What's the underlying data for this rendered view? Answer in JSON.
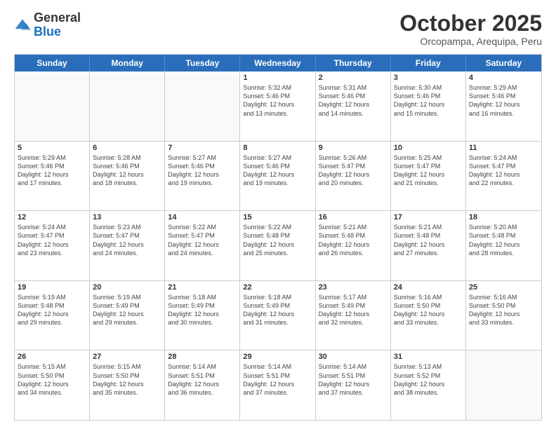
{
  "header": {
    "logo": {
      "line1": "General",
      "line2": "Blue"
    },
    "title": "October 2025",
    "subtitle": "Orcopampa, Arequipa, Peru"
  },
  "calendar": {
    "days_of_week": [
      "Sunday",
      "Monday",
      "Tuesday",
      "Wednesday",
      "Thursday",
      "Friday",
      "Saturday"
    ],
    "rows": [
      [
        {
          "day": "",
          "lines": [],
          "empty": true
        },
        {
          "day": "",
          "lines": [],
          "empty": true
        },
        {
          "day": "",
          "lines": [],
          "empty": true
        },
        {
          "day": "1",
          "lines": [
            "Sunrise: 5:32 AM",
            "Sunset: 5:46 PM",
            "Daylight: 12 hours",
            "and 13 minutes."
          ]
        },
        {
          "day": "2",
          "lines": [
            "Sunrise: 5:31 AM",
            "Sunset: 5:46 PM",
            "Daylight: 12 hours",
            "and 14 minutes."
          ]
        },
        {
          "day": "3",
          "lines": [
            "Sunrise: 5:30 AM",
            "Sunset: 5:46 PM",
            "Daylight: 12 hours",
            "and 15 minutes."
          ]
        },
        {
          "day": "4",
          "lines": [
            "Sunrise: 5:29 AM",
            "Sunset: 5:46 PM",
            "Daylight: 12 hours",
            "and 16 minutes."
          ]
        }
      ],
      [
        {
          "day": "5",
          "lines": [
            "Sunrise: 5:29 AM",
            "Sunset: 5:46 PM",
            "Daylight: 12 hours",
            "and 17 minutes."
          ]
        },
        {
          "day": "6",
          "lines": [
            "Sunrise: 5:28 AM",
            "Sunset: 5:46 PM",
            "Daylight: 12 hours",
            "and 18 minutes."
          ]
        },
        {
          "day": "7",
          "lines": [
            "Sunrise: 5:27 AM",
            "Sunset: 5:46 PM",
            "Daylight: 12 hours",
            "and 19 minutes."
          ]
        },
        {
          "day": "8",
          "lines": [
            "Sunrise: 5:27 AM",
            "Sunset: 5:46 PM",
            "Daylight: 12 hours",
            "and 19 minutes."
          ]
        },
        {
          "day": "9",
          "lines": [
            "Sunrise: 5:26 AM",
            "Sunset: 5:47 PM",
            "Daylight: 12 hours",
            "and 20 minutes."
          ]
        },
        {
          "day": "10",
          "lines": [
            "Sunrise: 5:25 AM",
            "Sunset: 5:47 PM",
            "Daylight: 12 hours",
            "and 21 minutes."
          ]
        },
        {
          "day": "11",
          "lines": [
            "Sunrise: 5:24 AM",
            "Sunset: 5:47 PM",
            "Daylight: 12 hours",
            "and 22 minutes."
          ]
        }
      ],
      [
        {
          "day": "12",
          "lines": [
            "Sunrise: 5:24 AM",
            "Sunset: 5:47 PM",
            "Daylight: 12 hours",
            "and 23 minutes."
          ]
        },
        {
          "day": "13",
          "lines": [
            "Sunrise: 5:23 AM",
            "Sunset: 5:47 PM",
            "Daylight: 12 hours",
            "and 24 minutes."
          ]
        },
        {
          "day": "14",
          "lines": [
            "Sunrise: 5:22 AM",
            "Sunset: 5:47 PM",
            "Daylight: 12 hours",
            "and 24 minutes."
          ]
        },
        {
          "day": "15",
          "lines": [
            "Sunrise: 5:22 AM",
            "Sunset: 5:48 PM",
            "Daylight: 12 hours",
            "and 25 minutes."
          ]
        },
        {
          "day": "16",
          "lines": [
            "Sunrise: 5:21 AM",
            "Sunset: 5:48 PM",
            "Daylight: 12 hours",
            "and 26 minutes."
          ]
        },
        {
          "day": "17",
          "lines": [
            "Sunrise: 5:21 AM",
            "Sunset: 5:48 PM",
            "Daylight: 12 hours",
            "and 27 minutes."
          ]
        },
        {
          "day": "18",
          "lines": [
            "Sunrise: 5:20 AM",
            "Sunset: 5:48 PM",
            "Daylight: 12 hours",
            "and 28 minutes."
          ]
        }
      ],
      [
        {
          "day": "19",
          "lines": [
            "Sunrise: 5:19 AM",
            "Sunset: 5:48 PM",
            "Daylight: 12 hours",
            "and 29 minutes."
          ]
        },
        {
          "day": "20",
          "lines": [
            "Sunrise: 5:19 AM",
            "Sunset: 5:49 PM",
            "Daylight: 12 hours",
            "and 29 minutes."
          ]
        },
        {
          "day": "21",
          "lines": [
            "Sunrise: 5:18 AM",
            "Sunset: 5:49 PM",
            "Daylight: 12 hours",
            "and 30 minutes."
          ]
        },
        {
          "day": "22",
          "lines": [
            "Sunrise: 5:18 AM",
            "Sunset: 5:49 PM",
            "Daylight: 12 hours",
            "and 31 minutes."
          ]
        },
        {
          "day": "23",
          "lines": [
            "Sunrise: 5:17 AM",
            "Sunset: 5:49 PM",
            "Daylight: 12 hours",
            "and 32 minutes."
          ]
        },
        {
          "day": "24",
          "lines": [
            "Sunrise: 5:16 AM",
            "Sunset: 5:50 PM",
            "Daylight: 12 hours",
            "and 33 minutes."
          ]
        },
        {
          "day": "25",
          "lines": [
            "Sunrise: 5:16 AM",
            "Sunset: 5:50 PM",
            "Daylight: 12 hours",
            "and 33 minutes."
          ]
        }
      ],
      [
        {
          "day": "26",
          "lines": [
            "Sunrise: 5:15 AM",
            "Sunset: 5:50 PM",
            "Daylight: 12 hours",
            "and 34 minutes."
          ]
        },
        {
          "day": "27",
          "lines": [
            "Sunrise: 5:15 AM",
            "Sunset: 5:50 PM",
            "Daylight: 12 hours",
            "and 35 minutes."
          ]
        },
        {
          "day": "28",
          "lines": [
            "Sunrise: 5:14 AM",
            "Sunset: 5:51 PM",
            "Daylight: 12 hours",
            "and 36 minutes."
          ]
        },
        {
          "day": "29",
          "lines": [
            "Sunrise: 5:14 AM",
            "Sunset: 5:51 PM",
            "Daylight: 12 hours",
            "and 37 minutes."
          ]
        },
        {
          "day": "30",
          "lines": [
            "Sunrise: 5:14 AM",
            "Sunset: 5:51 PM",
            "Daylight: 12 hours",
            "and 37 minutes."
          ]
        },
        {
          "day": "31",
          "lines": [
            "Sunrise: 5:13 AM",
            "Sunset: 5:52 PM",
            "Daylight: 12 hours",
            "and 38 minutes."
          ]
        },
        {
          "day": "",
          "lines": [],
          "empty": true
        }
      ]
    ]
  }
}
